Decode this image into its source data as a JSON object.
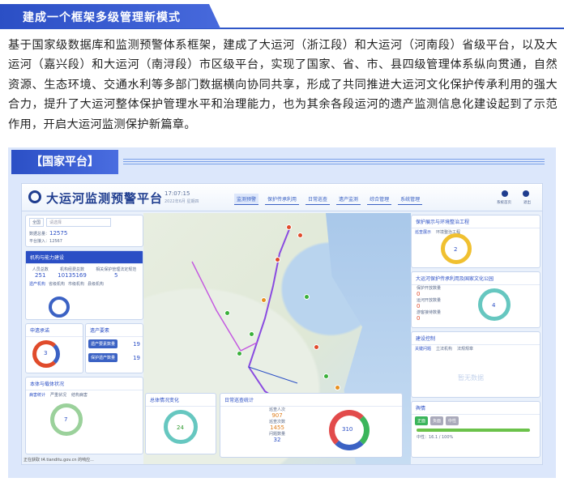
{
  "header": {
    "title": "建成一个框架多级管理新模式"
  },
  "paragraph": "基于国家级数据库和监测预警体系框架，建成了大运河（浙江段）和大运河（河南段）省级平台，以及大运河（嘉兴段）和大运河（南浔段）市区级平台，实现了国家、省、市、县四级管理体系纵向贯通，自然资源、生态环境、交通水利等多部门数据横向协同共享，形成了共同推进大运河文化保护传承利用的强大合力，提升了大运河整体保护管理水平和治理能力，也为其余各段运河的遗产监测信息化建设起到了示范作用，开启大运河监测保护新篇章。",
  "panel": {
    "tab_label": "【国家平台】"
  },
  "app": {
    "title": "大运河监测预警平台",
    "time": "17:07:15",
    "date": "2022年6月 星期四",
    "nav": [
      "监测预警",
      "保护传承利用",
      "日常巡查",
      "遗产监测",
      "综合管理",
      "系统管理"
    ],
    "top_right": [
      "系统首页",
      "退出"
    ],
    "left": {
      "search_select": "全国",
      "search_placeholder": "请选择",
      "stat1_label": "数据总量：",
      "stat1_value": "12575",
      "stat2_label": "平台接入：",
      "stat2_value": "12567",
      "card_org_title": "机构与能力建设",
      "org_labels": [
        "人员总数",
        "机构经费总数",
        "相关保护管理法定规范"
      ],
      "org_values": [
        "251",
        "10135169",
        "5"
      ],
      "org_tabs": [
        "遗产机构",
        "省级机构",
        "市级机构",
        "县级机构"
      ],
      "card_apply_title": "申遗承诺",
      "apply_value": "3",
      "card_elem_title": "遗产要素",
      "elem_rows": [
        "遗产要素数量",
        "保护遗产数量"
      ],
      "elem_values": [
        "19",
        "19"
      ],
      "card_body_title": "本体与载体状况",
      "body_tabs": [
        "病害统计",
        "严重状况",
        "结构病害"
      ],
      "body_value": "7"
    },
    "middle": {
      "card_env_title": "总体情况变化",
      "env_value": "24",
      "card_daily_title": "日常巡查统计",
      "daily_labels": [
        "巡查人次",
        "巡查次数",
        "问题数量"
      ],
      "daily_values": [
        "907",
        "1455",
        "32"
      ],
      "daily_center": "310"
    },
    "right": {
      "card_ecology_title": "保护展示与环境整治工程",
      "card_ecology_tabs": [
        "巡查展示",
        "环境整治工程"
      ],
      "ecology_value": "2",
      "card_tour_title": "大运河保护传承利用及国家文化公园",
      "tour_rows": [
        "保护开放数量",
        "运河开放数量",
        "游客接待数量"
      ],
      "tour_values": [
        "0",
        "0",
        "0"
      ],
      "tour_value": "4",
      "card_plan_title": "建设控制",
      "plan_tabs": [
        "关键问题",
        "立法机构",
        "法规规章"
      ],
      "watermark": "暂无数据",
      "card_prog_title": "舆情",
      "prog_tabs": [
        "正面",
        "负面",
        "中性"
      ],
      "prog_label": "中性：16.1 / 100%"
    },
    "footnote": "正在获取 t4.tianditu.gov.cn 的响应..."
  }
}
